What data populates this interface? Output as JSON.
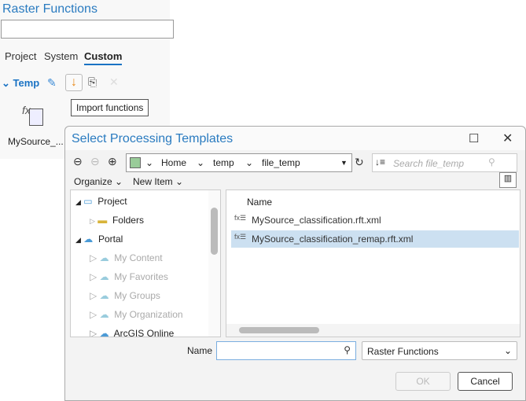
{
  "panel": {
    "title": "Raster Functions",
    "tabs": [
      "Project",
      "System",
      "Custom"
    ],
    "group": "Temp",
    "tooltip": "Import functions",
    "item": "MySource_..."
  },
  "dialog": {
    "title": "Select Processing Templates",
    "breadcrumb": [
      "Home",
      "temp",
      "file_temp"
    ],
    "search_placeholder": "Search file_temp",
    "organize": "Organize",
    "new_item": "New Item",
    "tree": [
      {
        "label": "Project",
        "disabled": false
      },
      {
        "label": "Folders",
        "disabled": false
      },
      {
        "label": "Portal",
        "disabled": false
      },
      {
        "label": "My Content",
        "disabled": true
      },
      {
        "label": "My Favorites",
        "disabled": true
      },
      {
        "label": "My Groups",
        "disabled": true
      },
      {
        "label": "My Organization",
        "disabled": true
      },
      {
        "label": "ArcGIS Online",
        "disabled": false
      }
    ],
    "column": "Name",
    "files": [
      "MySource_classification.rft.xml",
      "MySource_classification_remap.rft.xml"
    ],
    "name_label": "Name",
    "name_value": "",
    "filter": "Raster Functions",
    "ok": "OK",
    "cancel": "Cancel"
  }
}
